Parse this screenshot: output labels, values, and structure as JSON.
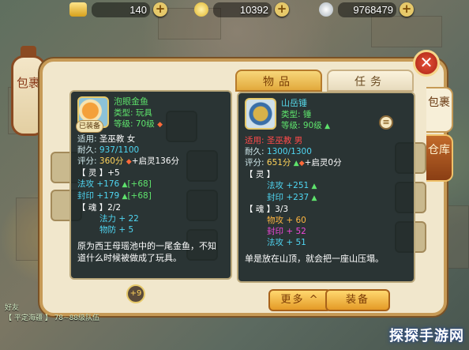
{
  "resources": [
    {
      "icon": "gold-ingot-icon",
      "value": "140"
    },
    {
      "icon": "coin-icon",
      "value": "10392"
    },
    {
      "icon": "silver-icon",
      "value": "9768479"
    }
  ],
  "resource_plus": "+",
  "lantern_label": "包裹",
  "close_label": "✕",
  "tabs": {
    "items": "物品",
    "tasks": "任务"
  },
  "side_tabs": {
    "bag": "包裹",
    "store": "仓库"
  },
  "left_item": {
    "name": "泡眼金鱼",
    "equipped_badge": "已装备",
    "type": "类型: 玩具",
    "level": "等级: 70级",
    "usage_label": "适用:",
    "usage_value": "圣巫教 女",
    "durability_label": "耐久:",
    "durability_value": "937/1100",
    "score_label": "评分:",
    "score_value": "360分",
    "score_extra": "+启灵136分",
    "ling_header": "【 灵 】+5",
    "ling_lines": [
      {
        "text": "法攻 +176",
        "bonus": "[+68]"
      },
      {
        "text": "封印 +179",
        "bonus": "[+68]"
      }
    ],
    "hun_header": "【 魂 】2/2",
    "hun_lines": [
      "法力 + 22",
      "物防 + 5"
    ],
    "description": "原为西王母瑶池中的一尾金鱼，不知道什么时候被做成了玩具。"
  },
  "right_item": {
    "name": "山岳锤",
    "type": "类型: 锤",
    "level": "等级: 90级",
    "usage_label": "适用:",
    "usage_value": "圣巫教 男",
    "durability_label": "耐久:",
    "durability_value": "1300/1300",
    "score_label": "评分:",
    "score_value": "651分",
    "score_extra": "+启灵0分",
    "ling_header": "【 灵 】",
    "ling_lines": [
      "法攻 +251",
      "封印 +237"
    ],
    "hun_header": "【 魂 】3/3",
    "hun_lines": [
      {
        "text": "物攻 + 60",
        "color": "orange"
      },
      {
        "text": "封印 + 52",
        "color": "magenta"
      },
      {
        "text": "法攻 + 51",
        "color": "cyan"
      }
    ],
    "description": "单是放在山顶，就会把一座山压塌。"
  },
  "enhance_badge": "+9",
  "bubble": "≡",
  "buttons": {
    "more": "更多 ^",
    "equip": "装备"
  },
  "chat_lines": [
    "好友",
    "【 平定海疆 】 78~88级队伍"
  ],
  "watermark": "探探手游网",
  "colors": {
    "accent": "#e6c96a",
    "panel": "#f1e7cc",
    "tooltip": "#14202a"
  }
}
